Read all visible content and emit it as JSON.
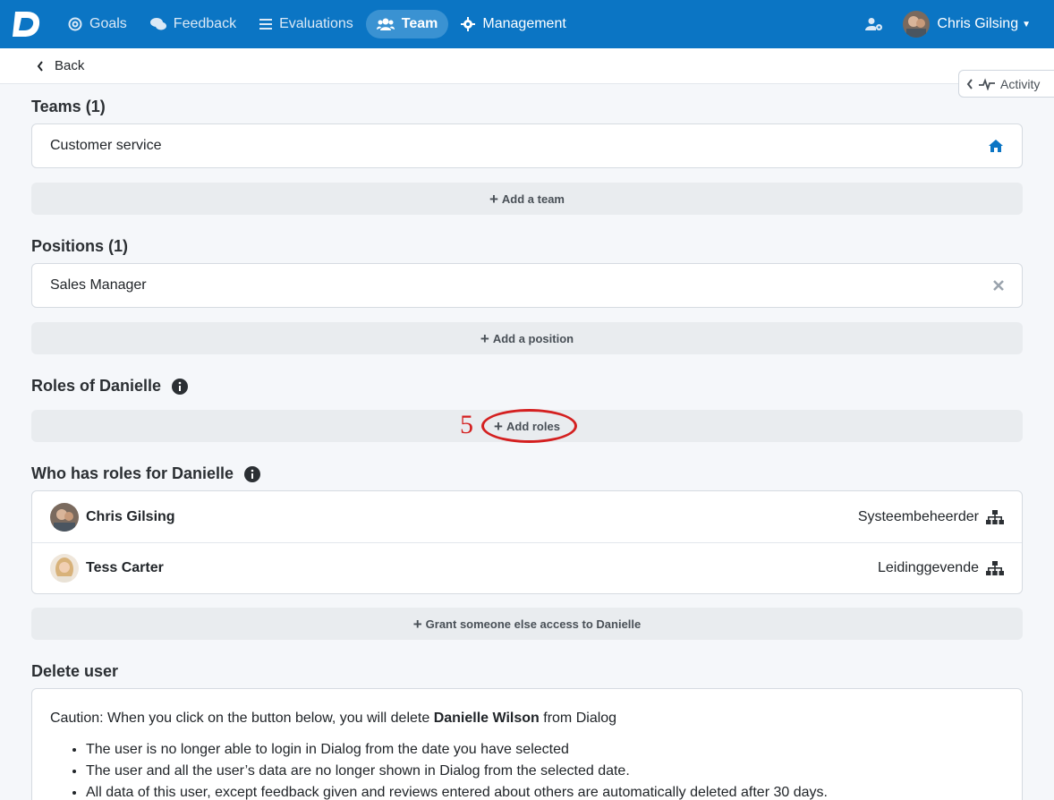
{
  "nav": {
    "items": [
      {
        "label": "Goals",
        "icon": "target-icon"
      },
      {
        "label": "Feedback",
        "icon": "comments-icon"
      },
      {
        "label": "Evaluations",
        "icon": "list-icon"
      },
      {
        "label": "Team",
        "icon": "users-icon",
        "active": true
      },
      {
        "label": "Management",
        "icon": "gear-icon"
      }
    ],
    "user_name": "Chris Gilsing"
  },
  "back_label": "Back",
  "activity_label": "Activity",
  "teams": {
    "title": "Teams (1)",
    "items": [
      "Customer service"
    ],
    "add_label": "Add a team"
  },
  "positions": {
    "title": "Positions (1)",
    "items": [
      "Sales Manager"
    ],
    "add_label": "Add a position"
  },
  "roles": {
    "title": "Roles of Danielle",
    "add_label": "Add roles"
  },
  "who_has_roles": {
    "title": "Who has roles for Danielle",
    "people": [
      {
        "name": "Chris Gilsing",
        "role": "Systeembeheerder"
      },
      {
        "name": "Tess Carter",
        "role": "Leidinggevende"
      }
    ],
    "grant_label": "Grant someone else access to Danielle"
  },
  "delete_user": {
    "title": "Delete user",
    "caution_prefix": "Caution: When you click on the button below, you will delete ",
    "caution_name": "Danielle Wilson",
    "caution_suffix": " from Dialog",
    "bullets": [
      "The user is no longer able to login in Dialog from the date you have selected",
      "The user and all the user’s data are no longer shown in Dialog from the selected date.",
      "All data of this user, except feedback given and reviews entered about others are automatically deleted after 30 days."
    ]
  },
  "annotation": {
    "number": "5"
  },
  "colors": {
    "brand": "#0b75c4",
    "annotation": "#d42020"
  }
}
